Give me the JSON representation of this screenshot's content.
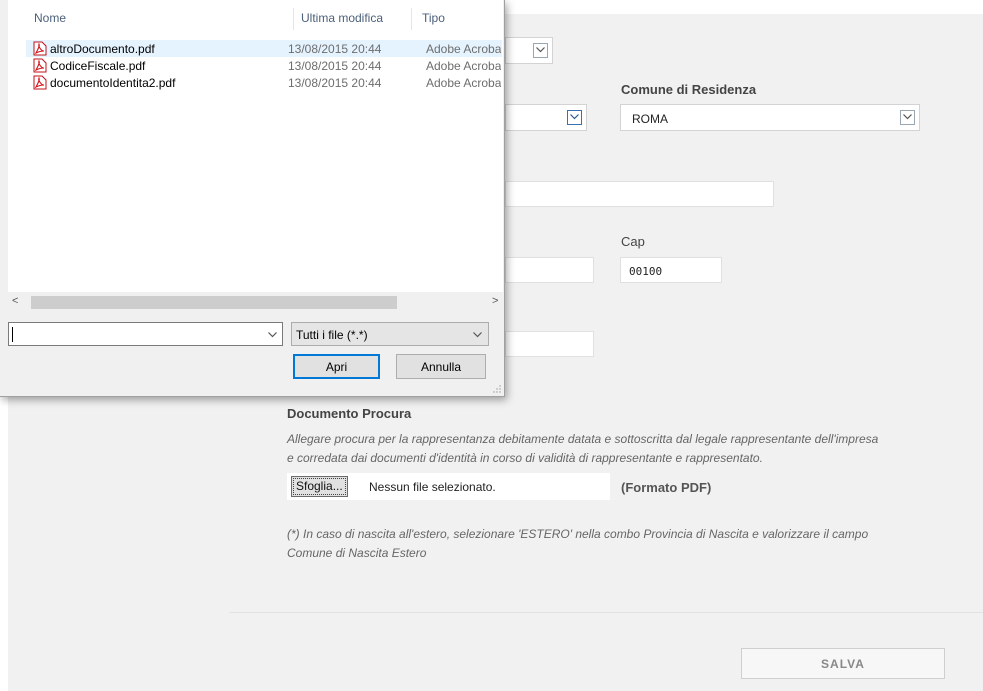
{
  "form": {
    "comune_residenza_label": "Comune di Residenza",
    "comune_residenza_value": "ROMA",
    "cap_label": "Cap",
    "cap_value": "00100",
    "documento_procura_label": "Documento Procura",
    "documento_procura_desc_1": "Allegare procura per la rappresentanza debitamente datata e sottoscritta dal legale rappresentante dell'impresa",
    "documento_procura_desc_2": "e corredata dai documenti d'identità in corso di validità di rappresentante e rappresentato.",
    "browse_label": "Sfoglia...",
    "no_file_label": "Nessun file selezionato.",
    "format_label": "(Formato PDF)",
    "note_1": "(*) In caso di nascita all'estero, selezionare 'ESTERO' nella combo Provincia di Nascita e valorizzare il campo",
    "note_2": "Comune di Nascita Estero",
    "save_label": "SALVA"
  },
  "dialog": {
    "columns": [
      "Nome",
      "Ultima modifica",
      "Tipo"
    ],
    "files": [
      {
        "name": "altroDocumento.pdf",
        "modified": "13/08/2015 20:44",
        "type": "Adobe Acrobat Document"
      },
      {
        "name": "CodiceFiscale.pdf",
        "modified": "13/08/2015 20:44",
        "type": "Adobe Acrobat Document"
      },
      {
        "name": "documentoIdentita2.pdf",
        "modified": "13/08/2015 20:44",
        "type": "Adobe Acrobat Document"
      }
    ],
    "filename_value": "",
    "filetype_value": "Tutti i file (*.*)",
    "open_label": "Apri",
    "cancel_label": "Annulla"
  },
  "icons": {
    "pdf": "pdf-file-icon",
    "dropdown": "chevron-down-icon",
    "scroll_left": "scroll-left-arrow-icon",
    "scroll_right": "scroll-right-arrow-icon",
    "resize": "resize-grip-icon"
  },
  "colors": {
    "pdf_red": "#d0121b",
    "selected_row": "#e5f3ff",
    "primary_border": "#0078d7"
  }
}
